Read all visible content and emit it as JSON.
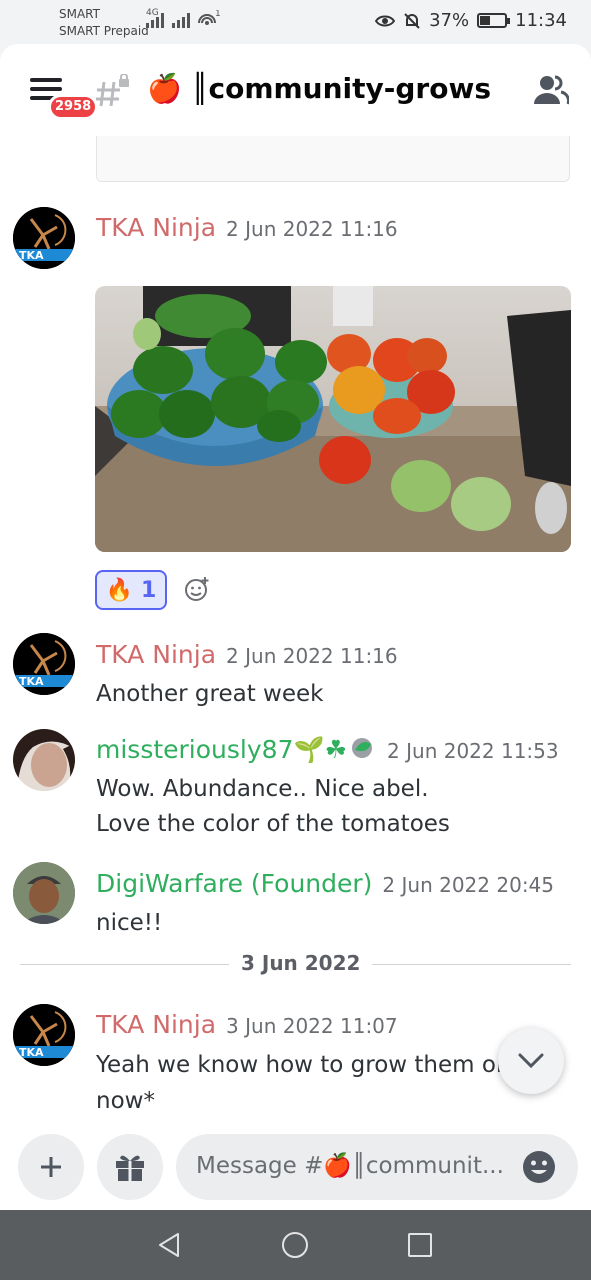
{
  "status_bar": {
    "carrier_line1": "SMART",
    "carrier_line2": "SMART Prepaid",
    "network_type": "4G",
    "notification_count": "1",
    "battery_percent": "37%",
    "battery_level": 0.37,
    "time": "11:34"
  },
  "header": {
    "mention_count": "2958",
    "channel_emoji": "🍎",
    "channel_name": "║community-grows"
  },
  "messages": [
    {
      "author": "TKA Ninja",
      "timestamp": "2 Jun 2022 11:16"
    },
    {
      "author": "TKA Ninja",
      "timestamp": "2 Jun 2022 11:16",
      "text": "Another great week"
    },
    {
      "author": "missteriously87",
      "author_emojis": "🌱☘",
      "timestamp": "2 Jun 2022 11:53",
      "lines": [
        "Wow. Abundance.. Nice abel.",
        "Love the color of the tomatoes"
      ]
    },
    {
      "author": "DigiWarfare (Founder)",
      "timestamp": "2 Jun 2022 20:45",
      "text": "nice!!"
    },
    {
      "author": "TKA Ninja",
      "timestamp": "3 Jun 2022 11:07",
      "lines": [
        "Yeah we know how to grow them onv",
        "now*"
      ]
    }
  ],
  "reaction": {
    "emoji": "🔥",
    "count": "1"
  },
  "date_divider": "3 Jun 2022",
  "composer": {
    "placeholder": "Message #🍎║communit..."
  },
  "colors": {
    "accent": "#5865f2",
    "author_red": "#d16b6b",
    "author_green": "#2fae5e",
    "badge_red": "#ed4245"
  },
  "icons": {
    "menu": "hamburger-icon",
    "channel": "locked-hash-icon",
    "members": "members-icon",
    "add_reaction": "add-reaction-icon",
    "jump": "chevron-down-icon",
    "plus": "plus-icon",
    "gift": "gift-icon",
    "emoji": "emoji-icon",
    "back": "back-icon",
    "home": "home-icon",
    "recents": "recents-icon"
  }
}
